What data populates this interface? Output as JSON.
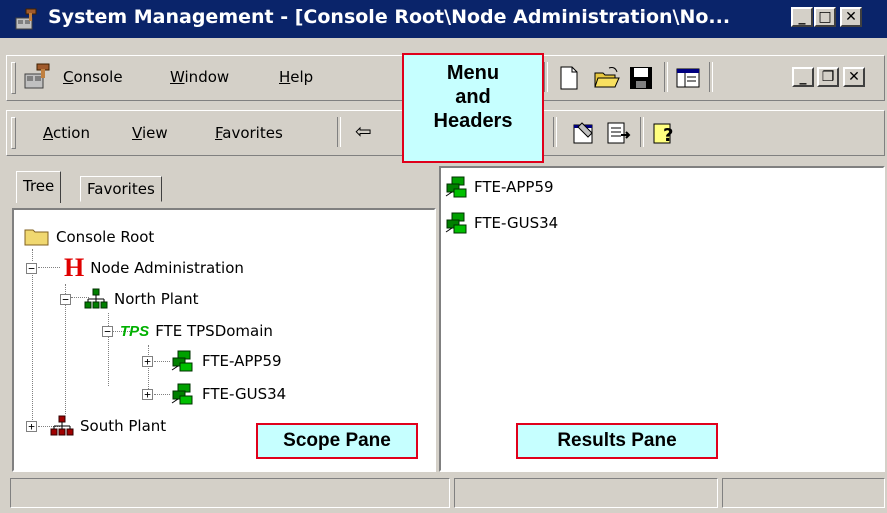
{
  "window": {
    "title": "System Management - [Console Root\\Node Administration\\No...",
    "controls": {
      "minimize": "_",
      "maximize": "□",
      "close": "✕"
    }
  },
  "menubar": {
    "items": [
      {
        "label_pre": "",
        "label_u": "C",
        "label_post": "onsole"
      },
      {
        "label_pre": "",
        "label_u": "W",
        "label_post": "indow"
      },
      {
        "label_pre": "",
        "label_u": "H",
        "label_post": "elp"
      }
    ],
    "child_controls": {
      "minimize": "_",
      "restore": "❐",
      "close": "✕"
    }
  },
  "actionbar": {
    "items": [
      {
        "label_pre": "",
        "label_u": "A",
        "label_post": "ction"
      },
      {
        "label_pre": "",
        "label_u": "V",
        "label_post": "iew"
      },
      {
        "label_pre": "",
        "label_u": "F",
        "label_post": "avorites"
      }
    ],
    "back_arrow": "⇦"
  },
  "annotations": {
    "menu_headers": [
      "Menu",
      "and",
      "Headers"
    ],
    "scope_pane": "Scope Pane",
    "results_pane": "Results Pane"
  },
  "tabs": {
    "tree": "Tree",
    "favorites": "Favorites"
  },
  "tree": {
    "console_root": "Console Root",
    "node_admin": "Node Administration",
    "node_admin_icon": "H",
    "north_plant": "North Plant",
    "tps_icon": "TPS",
    "fte_domain": "FTE TPSDomain",
    "app59": "FTE-APP59",
    "gus34": "FTE-GUS34",
    "south_plant": "South Plant"
  },
  "results": {
    "items": [
      "FTE-APP59",
      "FTE-GUS34"
    ]
  },
  "colors": {
    "titlebar": "#0a246a",
    "annotation_border": "#e0001b",
    "annotation_fill": "#c6ffff"
  }
}
